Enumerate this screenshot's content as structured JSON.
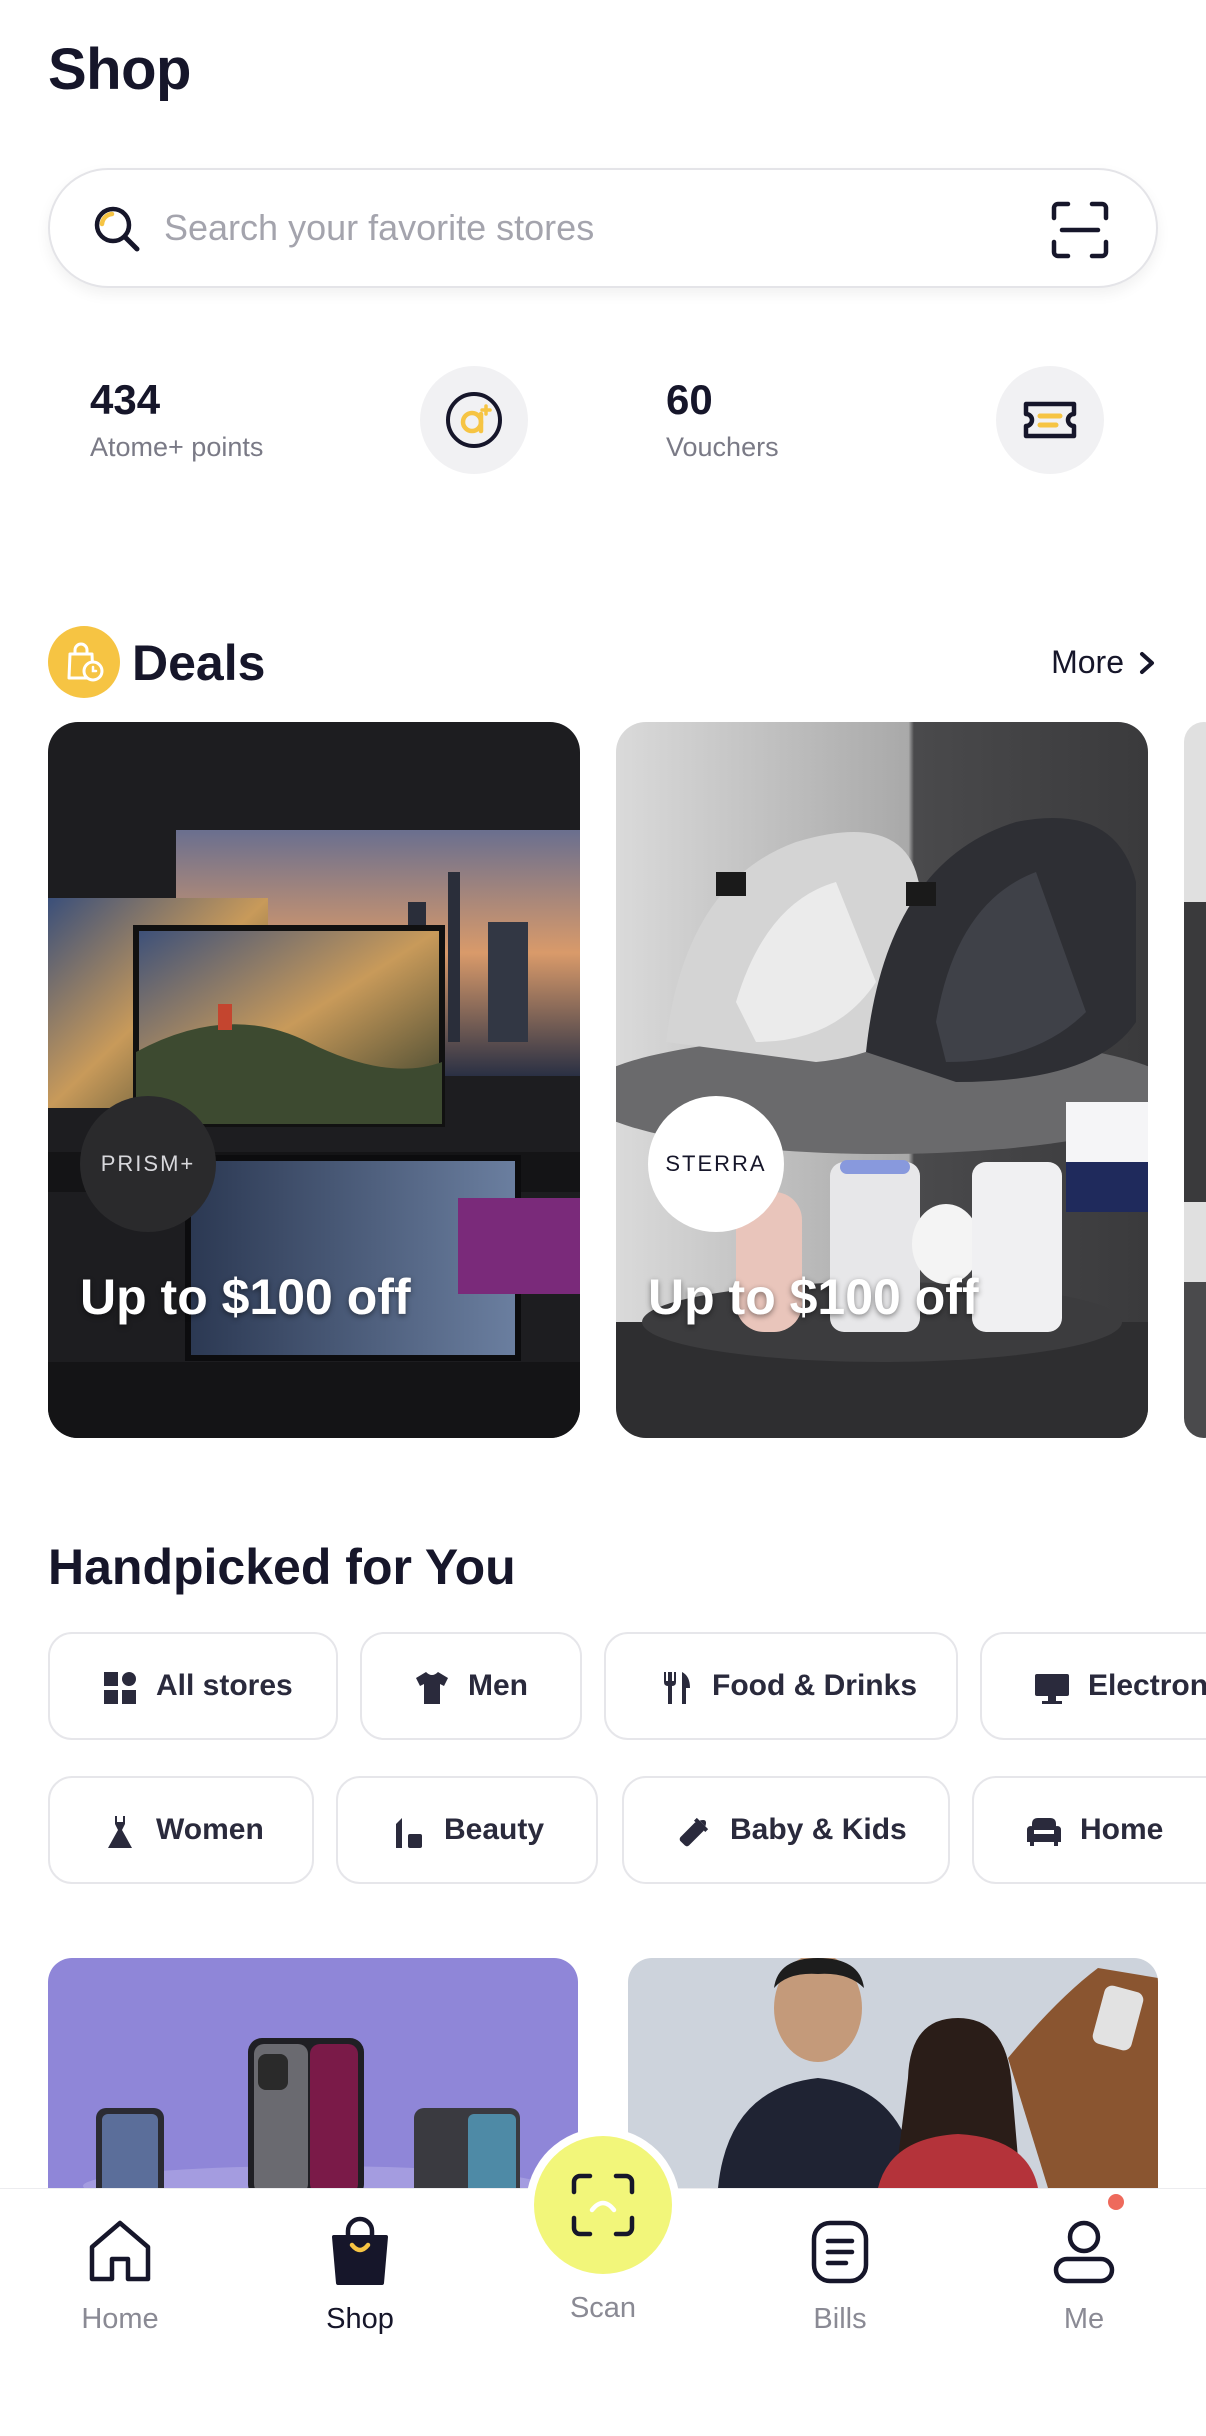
{
  "page": {
    "title": "Shop"
  },
  "search": {
    "placeholder": "Search your favorite stores"
  },
  "stats": {
    "points_value": "434",
    "points_label": "Atome+ points",
    "vouchers_value": "60",
    "vouchers_label": "Vouchers"
  },
  "deals": {
    "title": "Deals",
    "more_label": "More",
    "cards": [
      {
        "brand": "PRISM+",
        "text": "Up to $100 off"
      },
      {
        "brand": "STERRA",
        "text": "Up to $100 off"
      }
    ]
  },
  "handpicked": {
    "title": "Handpicked for You",
    "categories": [
      {
        "label": "All stores",
        "icon": "grid-icon"
      },
      {
        "label": "Men",
        "icon": "shirt-icon"
      },
      {
        "label": "Food & Drinks",
        "icon": "fork-knife-icon"
      },
      {
        "label": "Electron",
        "icon": "monitor-icon"
      },
      {
        "label": "Women",
        "icon": "dress-icon"
      },
      {
        "label": "Beauty",
        "icon": "cosmetics-icon"
      },
      {
        "label": "Baby & Kids",
        "icon": "baby-bottle-icon"
      },
      {
        "label": "Home",
        "icon": "sofa-icon"
      }
    ]
  },
  "nav": {
    "items": [
      {
        "label": "Home",
        "icon": "home-icon"
      },
      {
        "label": "Shop",
        "icon": "shopping-bag-icon"
      },
      {
        "label": "Scan",
        "icon": "scan-icon"
      },
      {
        "label": "Bills",
        "icon": "bills-icon"
      },
      {
        "label": "Me",
        "icon": "profile-icon"
      }
    ],
    "active": "Shop"
  },
  "colors": {
    "accent_yellow": "#f6c443",
    "scan_fab": "#f2f67a",
    "text_dark": "#16162a",
    "text_muted": "#7a7a86",
    "notification": "#ee6a5c"
  }
}
